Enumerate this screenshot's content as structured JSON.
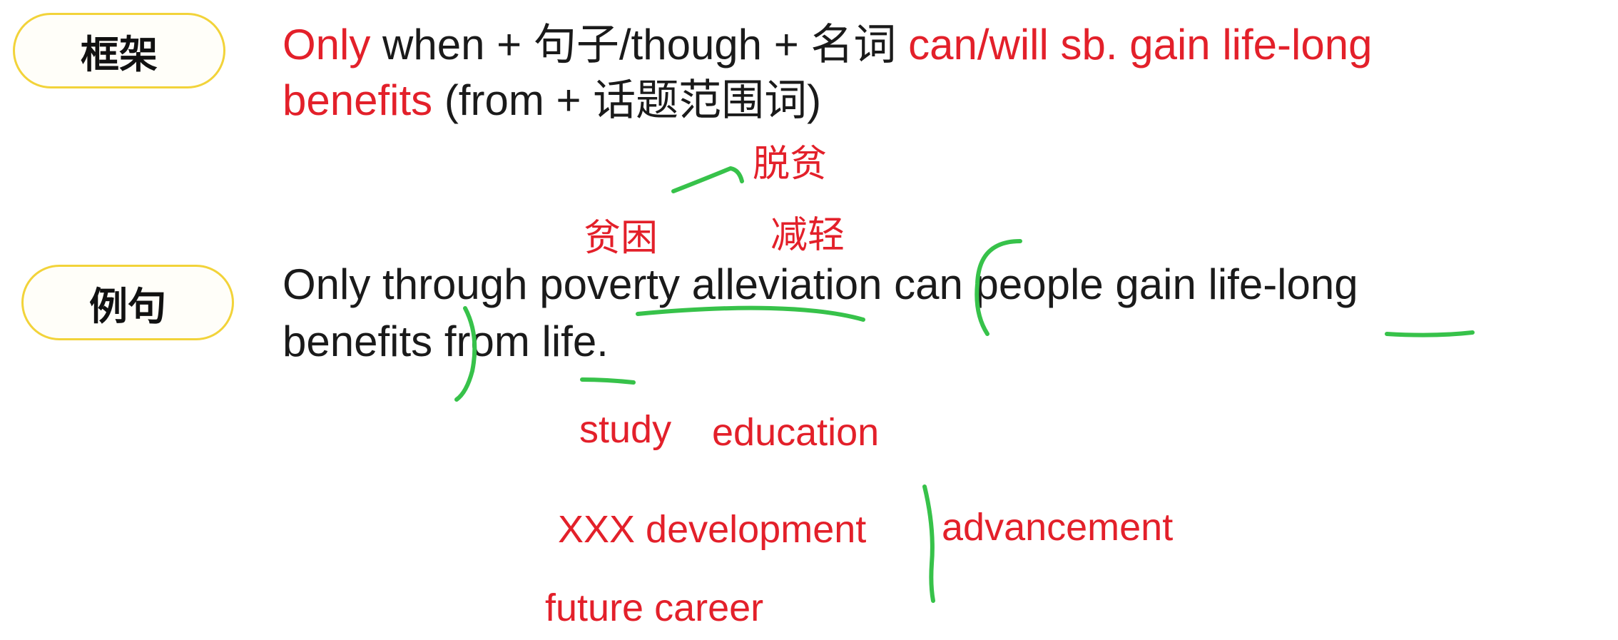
{
  "labels": {
    "frame": "框架",
    "example": "例句"
  },
  "frame": {
    "line1": {
      "only": "Only",
      "middle": " when + 句子/though + 名词 ",
      "tail": "can/will sb. gain life-long"
    },
    "line2": {
      "benefits": "benefits",
      "tail": " (from + 话题范围词)"
    }
  },
  "example": {
    "line1": "Only through poverty alleviation can people gain life-long",
    "line2": "benefits from life."
  },
  "annotations": {
    "tuopin": "脱贫",
    "pinkun": "贫困",
    "jianqing": "减轻",
    "study": "study",
    "education": "education",
    "xxx_development": "XXX development",
    "advancement": "advancement",
    "future_career": "future career"
  },
  "colors": {
    "accent_red": "#e3202a",
    "pill_border": "#f2d33a",
    "ink_green": "#37c24a",
    "text": "#1a1a1a"
  }
}
